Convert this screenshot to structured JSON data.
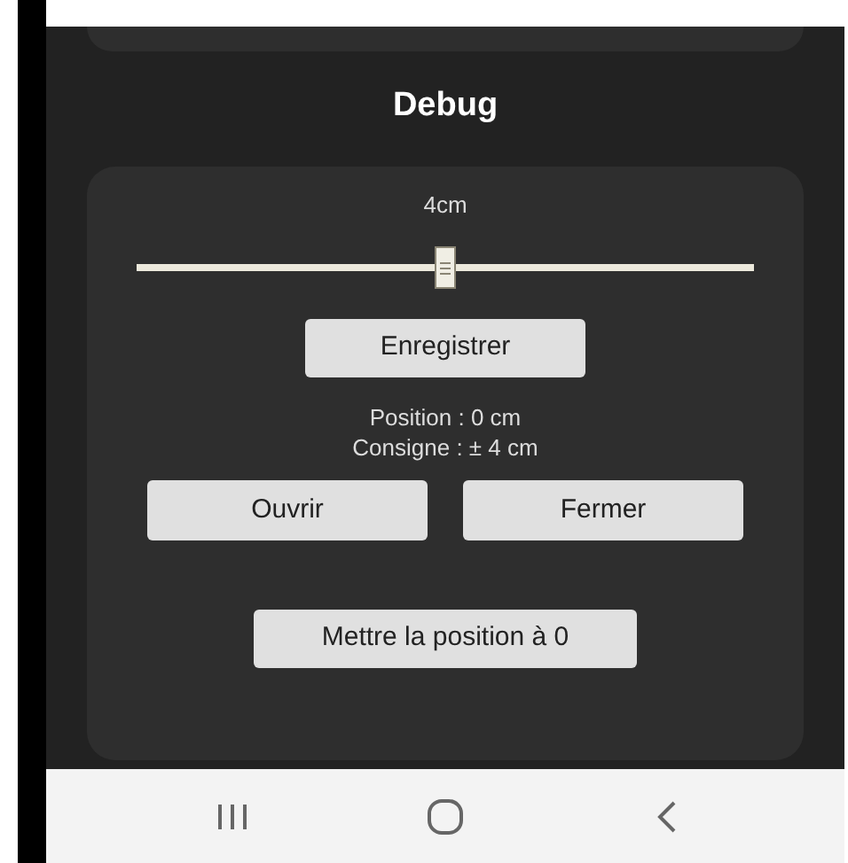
{
  "title": "Debug",
  "slider": {
    "reading": "4cm",
    "level": 0.5
  },
  "save_button": "Enregistrer",
  "status_lines": [
    "Position : 0 cm",
    "Consigne : ± 4 cm"
  ],
  "buttons": [
    "Ouvrir",
    "Fermer"
  ],
  "reset_button": "Mettre la position à 0"
}
